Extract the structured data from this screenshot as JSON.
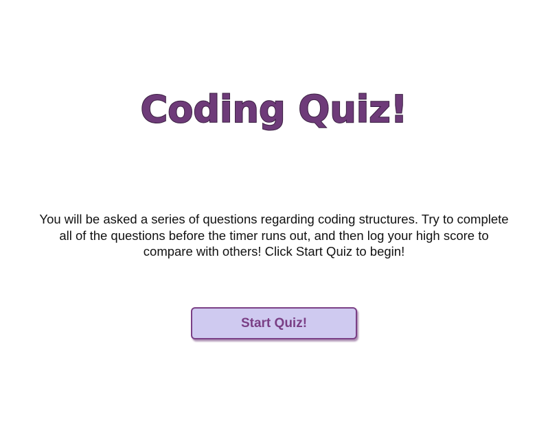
{
  "header": {
    "title": "Coding Quiz!"
  },
  "main": {
    "intro_text": "You will be asked a series of questions regarding coding structures. Try to complete all of the questions before the timer runs out, and then log your high score to compare with others! Click Start Quiz to begin!",
    "start_button_label": "Start Quiz!"
  },
  "colors": {
    "title": "#6e3b79",
    "button_background": "#cfcaf0",
    "button_border": "#7a3f85",
    "button_text": "#7a3f85"
  }
}
